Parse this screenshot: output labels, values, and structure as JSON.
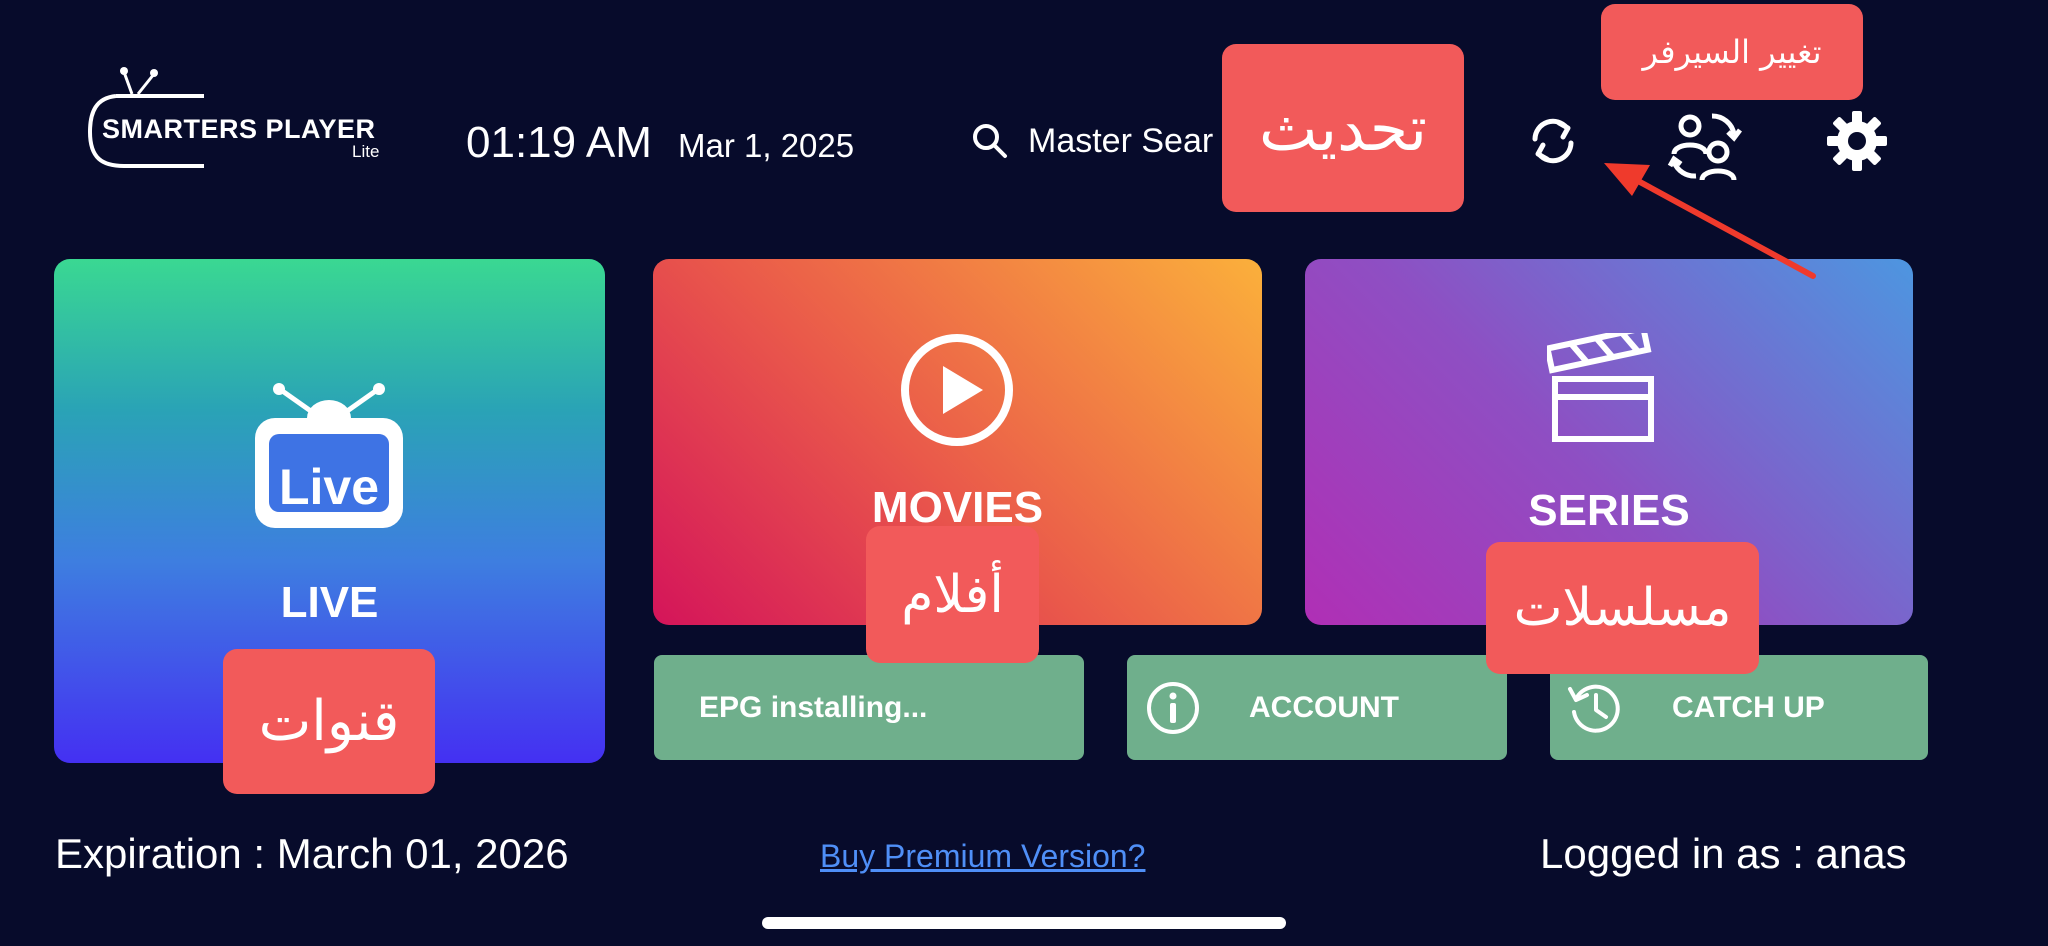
{
  "header": {
    "logo_name": "SMARTERS PLAYER",
    "logo_sub": "Lite",
    "time": "01:19 AM",
    "date": "Mar 1, 2025",
    "search_label": "Master Sear"
  },
  "tiles": {
    "live": "LIVE",
    "live_icon_text": "Live",
    "movies": "MOVIES",
    "series": "SERIES",
    "epg": "EPG installing...",
    "account": "ACCOUNT",
    "catch_up": "CATCH UP"
  },
  "footer": {
    "expiration": "Expiration : March 01, 2026",
    "premium_link": "Buy Premium Version?",
    "logged_in": "Logged in as : anas"
  },
  "annotations": {
    "update": "تحديث",
    "change_server": "تغيير السيرفر",
    "movies": "أفلام",
    "series": "مسلسلات",
    "channels": "قنوات"
  },
  "icons": {
    "search": "search-icon",
    "refresh": "refresh-icon",
    "switch_user": "switch-user-icon",
    "settings": "gear-icon",
    "tv": "tv-icon",
    "play": "play-icon",
    "clapperboard": "clapperboard-icon",
    "info": "info-icon",
    "history": "history-icon"
  },
  "colors": {
    "background": "#070b2b",
    "small_tile": "#6faf8c",
    "badge": "#f25a5a",
    "link": "#4f8ff7",
    "arrow": "#ef3a2c"
  }
}
